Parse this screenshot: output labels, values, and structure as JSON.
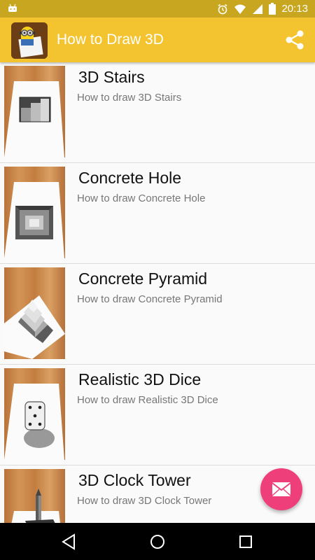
{
  "status_bar": {
    "time": "20:13"
  },
  "app_bar": {
    "title": "How to Draw 3D"
  },
  "items": [
    {
      "title": "3D Stairs",
      "subtitle": "How to draw 3D Stairs"
    },
    {
      "title": "Concrete Hole",
      "subtitle": "How to draw Concrete Hole"
    },
    {
      "title": "Concrete Pyramid",
      "subtitle": "How to draw Concrete Pyramid"
    },
    {
      "title": "Realistic 3D Dice",
      "subtitle": "How to draw Realistic 3D Dice"
    },
    {
      "title": "3D Clock Tower",
      "subtitle": "How to draw 3D Clock Tower"
    }
  ],
  "colors": {
    "status_bar": "#c9a61f",
    "app_bar": "#f4c430",
    "fab": "#ef3f7a"
  },
  "icons": {
    "status_left": "android-debug-icon",
    "alarm": "alarm-icon",
    "wifi": "wifi-icon",
    "signal": "signal-icon",
    "battery": "battery-icon",
    "share": "share-icon",
    "fab": "email-icon",
    "back": "back-icon",
    "home": "home-icon",
    "recents": "recents-icon"
  }
}
